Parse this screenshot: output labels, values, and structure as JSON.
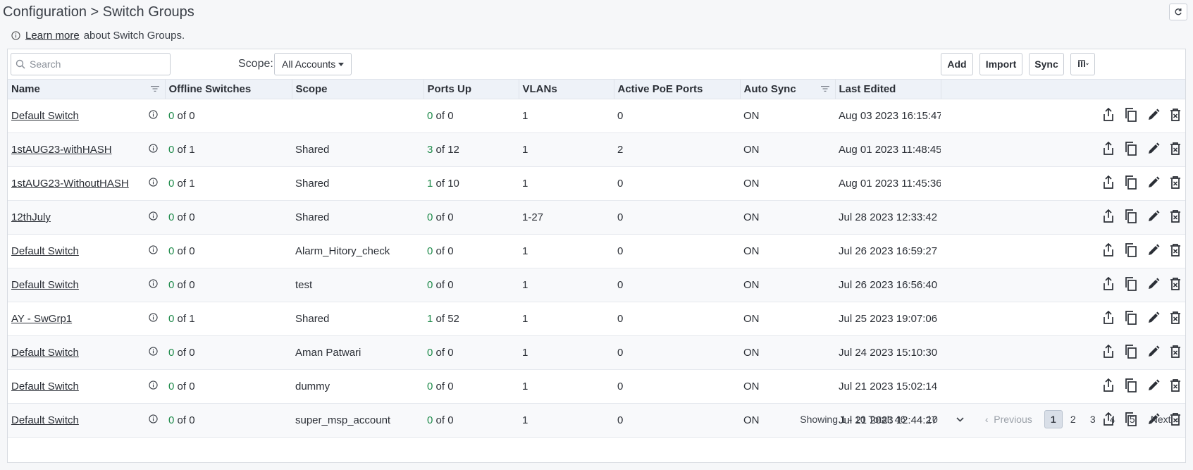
{
  "header": {
    "breadcrumb": "Configuration > Switch Groups"
  },
  "info": {
    "link": "Learn more",
    "text": "about Switch Groups."
  },
  "toolbar": {
    "search_placeholder": "Search",
    "scope_label": "Scope:",
    "scope_value": "All Accounts",
    "add_label": "Add",
    "import_label": "Import",
    "sync_label": "Sync"
  },
  "columns": [
    "Name",
    "Offline Switches",
    "Scope",
    "Ports Up",
    "VLANs",
    "Active PoE Ports",
    "Auto Sync",
    "Last Edited"
  ],
  "rows": [
    {
      "name": "Default Switch",
      "off_a": "0",
      "off_b": " of 0",
      "scope": "",
      "up_a": "0",
      "up_b": " of 0",
      "vlans": "1",
      "poe": "0",
      "sync": "ON",
      "edited": "Aug 03 2023 16:15:47"
    },
    {
      "name": "1stAUG23-withHASH",
      "off_a": "0",
      "off_b": " of 1",
      "scope": "Shared",
      "up_a": "3",
      "up_b": " of 12",
      "vlans": "1",
      "poe": "2",
      "sync": "ON",
      "edited": "Aug 01 2023 11:48:45"
    },
    {
      "name": "1stAUG23-WithoutHASH",
      "off_a": "0",
      "off_b": " of 1",
      "scope": "Shared",
      "up_a": "1",
      "up_b": " of 10",
      "vlans": "1",
      "poe": "0",
      "sync": "ON",
      "edited": "Aug 01 2023 11:45:36"
    },
    {
      "name": "12thJuly",
      "off_a": "0",
      "off_b": " of 0",
      "scope": "Shared",
      "up_a": "0",
      "up_b": " of 0",
      "vlans": "1-27",
      "poe": "0",
      "sync": "ON",
      "edited": "Jul 28 2023 12:33:42"
    },
    {
      "name": "Default Switch",
      "off_a": "0",
      "off_b": " of 0",
      "scope": "Alarm_Hitory_check",
      "up_a": "0",
      "up_b": " of 0",
      "vlans": "1",
      "poe": "0",
      "sync": "ON",
      "edited": "Jul 26 2023 16:59:27"
    },
    {
      "name": "Default Switch",
      "off_a": "0",
      "off_b": " of 0",
      "scope": "test",
      "up_a": "0",
      "up_b": " of 0",
      "vlans": "1",
      "poe": "0",
      "sync": "ON",
      "edited": "Jul 26 2023 16:56:40"
    },
    {
      "name": "AY - SwGrp1",
      "off_a": "0",
      "off_b": " of 1",
      "scope": "Shared",
      "up_a": "1",
      "up_b": " of 52",
      "vlans": "1",
      "poe": "0",
      "sync": "ON",
      "edited": "Jul 25 2023 19:07:06"
    },
    {
      "name": "Default Switch",
      "off_a": "0",
      "off_b": " of 0",
      "scope": "Aman Patwari",
      "up_a": "0",
      "up_b": " of 0",
      "vlans": "1",
      "poe": "0",
      "sync": "ON",
      "edited": "Jul 24 2023 15:10:30"
    },
    {
      "name": "Default Switch",
      "off_a": "0",
      "off_b": " of 0",
      "scope": "dummy",
      "up_a": "0",
      "up_b": " of 0",
      "vlans": "1",
      "poe": "0",
      "sync": "ON",
      "edited": "Jul 21 2023 15:02:14"
    },
    {
      "name": "Default Switch",
      "off_a": "0",
      "off_b": " of 0",
      "scope": "super_msp_account",
      "up_a": "0",
      "up_b": " of 0",
      "vlans": "1",
      "poe": "0",
      "sync": "ON",
      "edited": "Jul 21 2023 12:44:27"
    }
  ],
  "footer": {
    "showing": "Showing 1 - 10 Total: 46",
    "page_size": "10",
    "prev_label": "Previous",
    "next_label": "Next",
    "pages": [
      "1",
      "2",
      "3",
      "4",
      "5"
    ]
  },
  "icons": {
    "row_actions": [
      "export-icon",
      "copy-icon",
      "edit-icon",
      "delete-icon"
    ],
    "accent_green": "#1e8a4a"
  }
}
